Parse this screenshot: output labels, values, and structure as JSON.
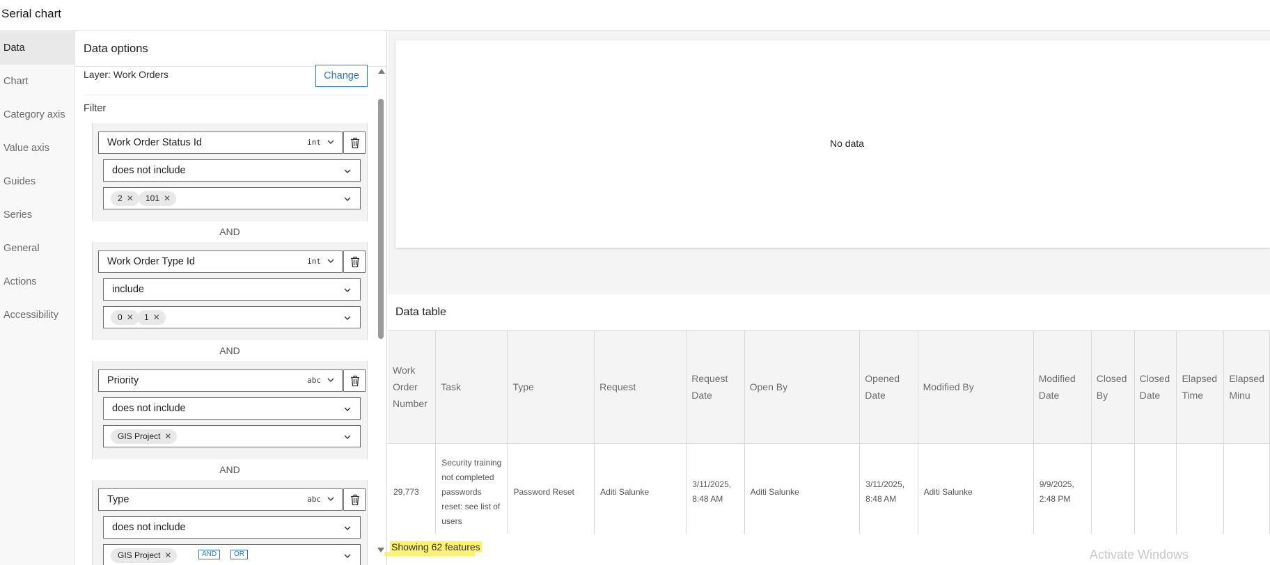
{
  "window": {
    "title": "Serial chart"
  },
  "nav": {
    "items": [
      {
        "label": "Data",
        "active": true
      },
      {
        "label": "Chart"
      },
      {
        "label": "Category axis"
      },
      {
        "label": "Value axis"
      },
      {
        "label": "Guides"
      },
      {
        "label": "Series"
      },
      {
        "label": "General"
      },
      {
        "label": "Actions"
      },
      {
        "label": "Accessibility"
      }
    ]
  },
  "panel": {
    "title": "Data options",
    "layer_label": "Layer: Work Orders",
    "change_label": "Change",
    "filter_label": "Filter",
    "clauses": [
      {
        "field": "Work Order Status Id",
        "type": "int",
        "operator": "does not include",
        "values": [
          "2",
          "101"
        ]
      },
      {
        "field": "Work Order Type Id",
        "type": "int",
        "operator": "include",
        "values": [
          "0",
          "1"
        ]
      },
      {
        "field": "Priority",
        "type": "abc",
        "operator": "does not include",
        "values": [
          "GIS Project"
        ]
      },
      {
        "field": "Type",
        "type": "abc",
        "operator": "does not include",
        "values": [
          "GIS Project"
        ]
      }
    ],
    "joiner": "AND",
    "add_buttons": [
      "AND",
      "OR"
    ]
  },
  "chart": {
    "empty_message": "No data"
  },
  "data_table": {
    "title": "Data table",
    "columns": [
      "Work Order Number",
      "Task",
      "Type",
      "Request",
      "Request Date",
      "Open By",
      "Opened Date",
      "Modified By",
      "Modified Date",
      "Closed By",
      "Closed Date",
      "Elapsed Time",
      "Elapsed Minu"
    ],
    "rows": [
      [
        "29,773",
        "Security training not completed passwords reset: see list of users",
        "Password Reset",
        "Aditi Salunke",
        "3/11/2025, 8:48 AM",
        "Aditi Salunke",
        "3/11/2025, 8:48 AM",
        "Aditi Salunke",
        "9/9/2025, 2:48 PM",
        "",
        "",
        "",
        ""
      ]
    ],
    "footer": "Showing 62 features"
  },
  "watermark": "Activate Windows"
}
